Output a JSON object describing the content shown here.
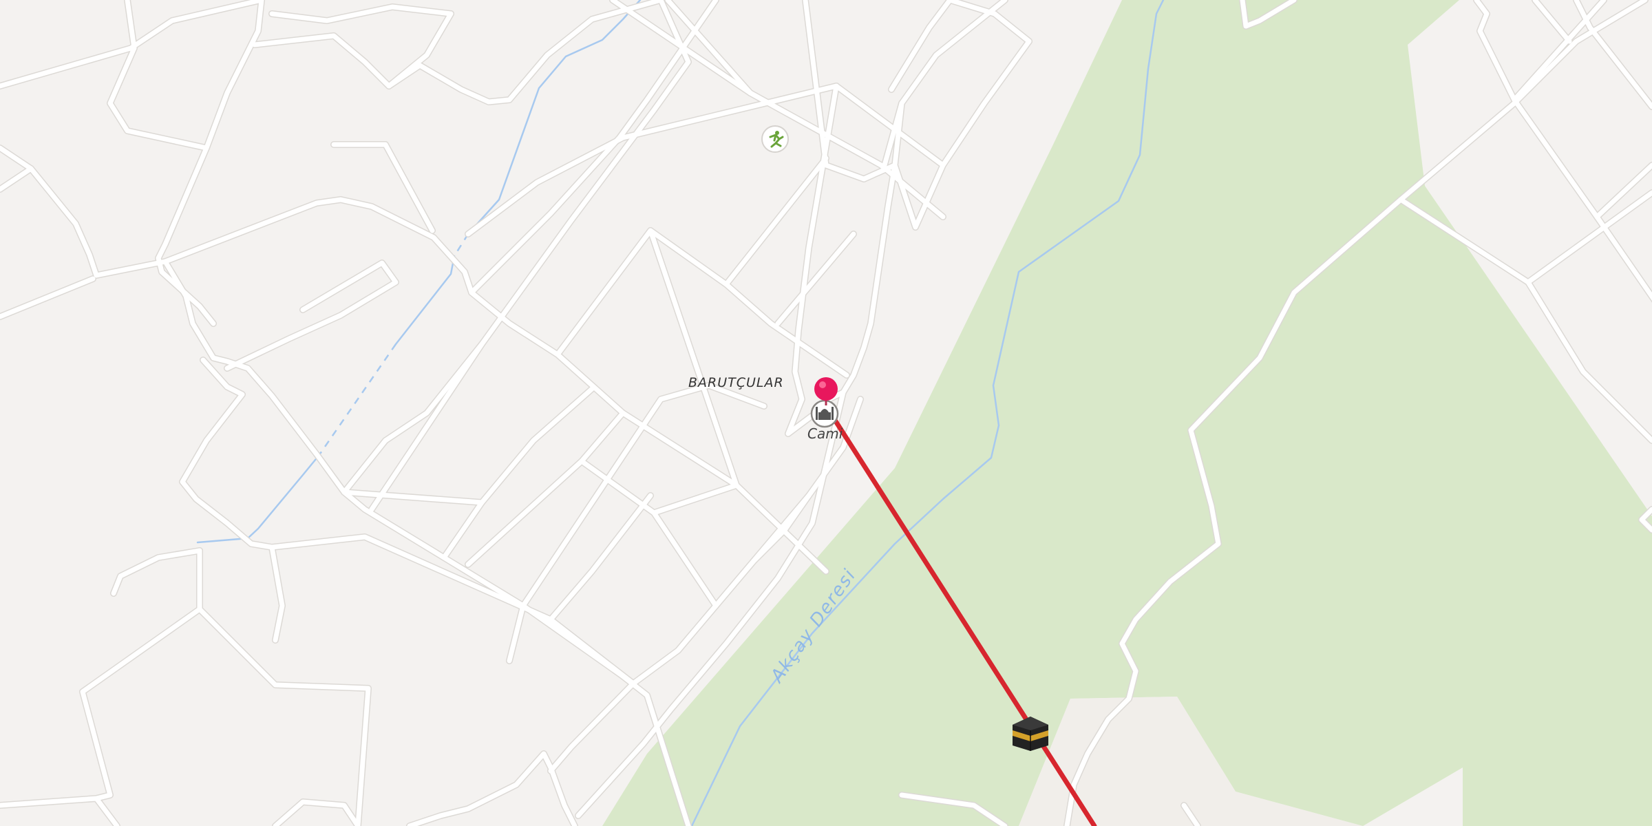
{
  "map": {
    "colors": {
      "land": "#f4f2f0",
      "park": "#d9e8c9",
      "road": "#ffffff",
      "water": "#a7c9ef",
      "route": "#d7262e",
      "pin": "#e8175d"
    },
    "labels": {
      "place": "BARUTÇULAR",
      "poi": "Cami",
      "stream": "Akçay Deresi"
    },
    "markers": {
      "pin": "location-pin-icon",
      "mosque": "mosque-icon",
      "sports": "running-person-icon",
      "destination": "kaaba-icon"
    }
  }
}
